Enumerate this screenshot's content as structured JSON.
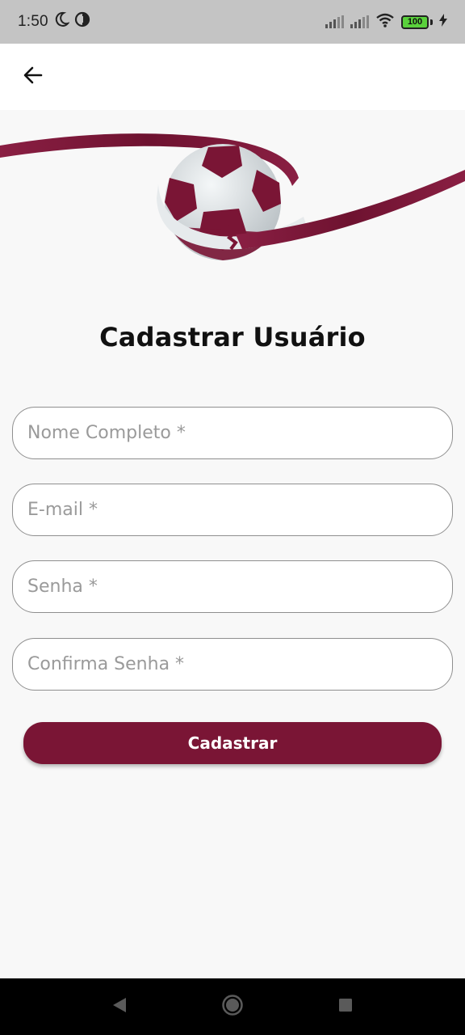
{
  "status_bar": {
    "time": "1:50",
    "battery_level": "100",
    "icons": [
      "moon-icon",
      "data-saver-icon",
      "signal-icon",
      "signal-icon",
      "wifi-icon",
      "battery-icon",
      "charging-icon"
    ]
  },
  "app_bar": {
    "back_icon": "arrow-left-icon"
  },
  "hero": {
    "image": "soccer-ball-ribbon-logo",
    "colors": {
      "maroon": "#7a1535",
      "ball_white": "#e8eced"
    }
  },
  "page": {
    "title": "Cadastrar Usuário"
  },
  "form": {
    "full_name": {
      "placeholder": "Nome Completo *",
      "value": ""
    },
    "email": {
      "placeholder": "E-mail *",
      "value": ""
    },
    "password": {
      "placeholder": "Senha *",
      "value": ""
    },
    "confirm_password": {
      "placeholder": "Confirma Senha *",
      "value": ""
    },
    "submit_label": "Cadastrar"
  },
  "nav_bar": {
    "icons": [
      "back-triangle-icon",
      "home-circle-icon",
      "recents-square-icon"
    ]
  },
  "colors": {
    "accent": "#7a1535",
    "background": "#f8f8f8",
    "status_bar": "#c4c4c4"
  }
}
